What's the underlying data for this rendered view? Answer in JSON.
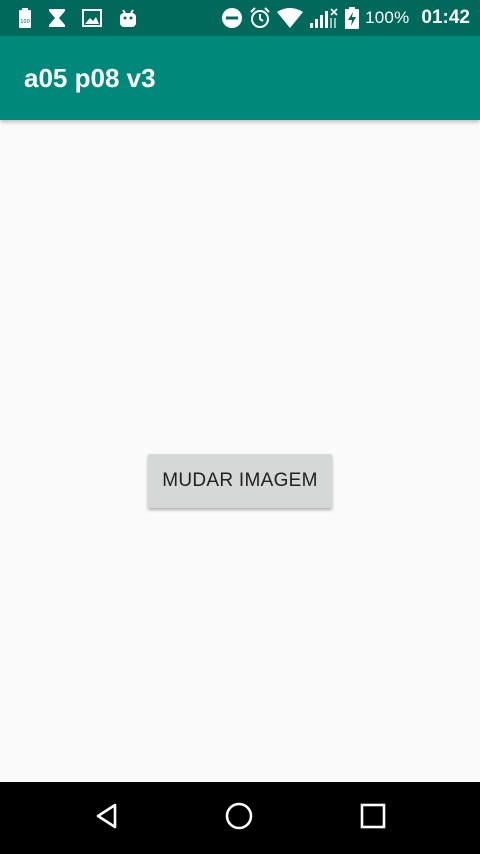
{
  "status_bar": {
    "battery_percent": "100%",
    "time": "01:42",
    "left_icons": [
      "battery-100-notification-icon",
      "hourglass-icon",
      "image-icon",
      "android-icon"
    ],
    "right_icons": [
      "do-not-disturb-icon",
      "alarm-icon",
      "wifi-icon",
      "signal-icon",
      "battery-charging-icon"
    ]
  },
  "app_bar": {
    "title": "a05 p08 v3"
  },
  "main": {
    "button_label": "MUDAR IMAGEM"
  },
  "nav_bar": {
    "icons": [
      "back-icon",
      "home-icon",
      "recents-icon"
    ]
  },
  "colors": {
    "status_bar": "#00695c",
    "app_bar": "#00897b",
    "background": "#fafafa",
    "button": "#d6d7d7"
  }
}
